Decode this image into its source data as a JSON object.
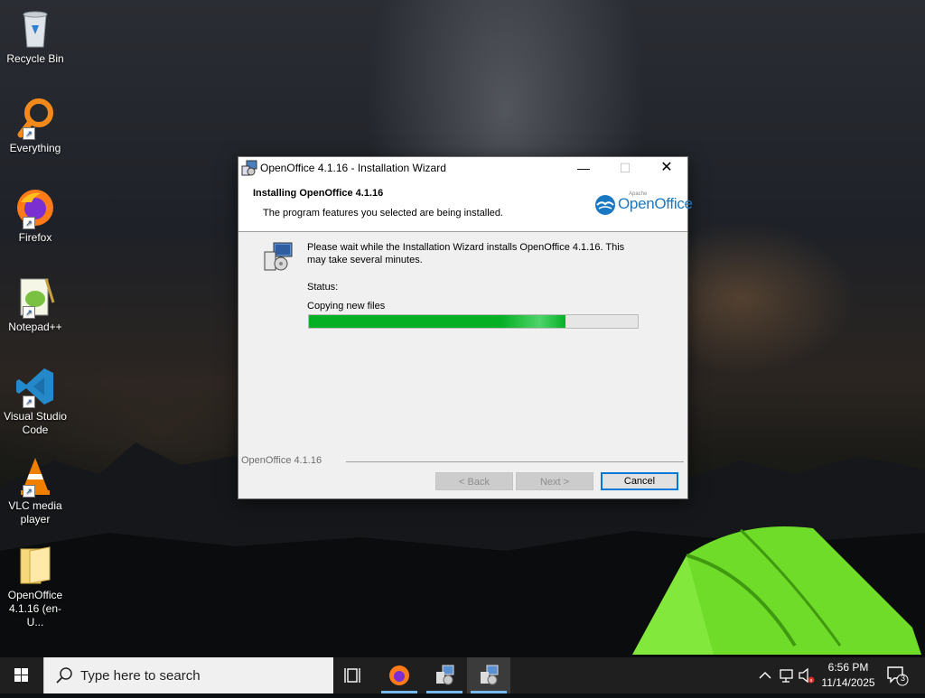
{
  "desktop": {
    "icons": [
      {
        "label": "Recycle Bin",
        "icon": "recycle-bin-icon"
      },
      {
        "label": "Everything",
        "icon": "everything-search-icon"
      },
      {
        "label": "Firefox",
        "icon": "firefox-icon"
      },
      {
        "label": "Notepad++",
        "icon": "notepad-plus-plus-icon"
      },
      {
        "label": "Visual Studio Code",
        "icon": "vscode-icon"
      },
      {
        "label": "VLC media player",
        "icon": "vlc-icon"
      },
      {
        "label": "OpenOffice 4.1.16 (en-U...",
        "icon": "folder-icon"
      }
    ]
  },
  "window": {
    "title": "OpenOffice 4.1.16 - Installation Wizard",
    "header_title": "Installing OpenOffice 4.1.16",
    "header_subtitle": "The program features you selected are being installed.",
    "logo_top": "Apache",
    "logo_brand": "OpenOffice",
    "message": "Please wait while the Installation Wizard installs OpenOffice 4.1.16. This may take several minutes.",
    "status_label": "Status:",
    "status_value": "Copying new files",
    "progress_fraction": 0.78,
    "footer_version": "OpenOffice 4.1.16",
    "buttons": {
      "back": "< Back",
      "next": "Next >",
      "cancel": "Cancel"
    }
  },
  "taskbar": {
    "search_placeholder": "Type here to search",
    "clock_time": "6:56 PM",
    "clock_date": "11/14/2025",
    "notification_count": "3"
  },
  "colors": {
    "progress": "#06b025",
    "accent": "#0078d7",
    "taskbar": "#1f1f1f"
  }
}
